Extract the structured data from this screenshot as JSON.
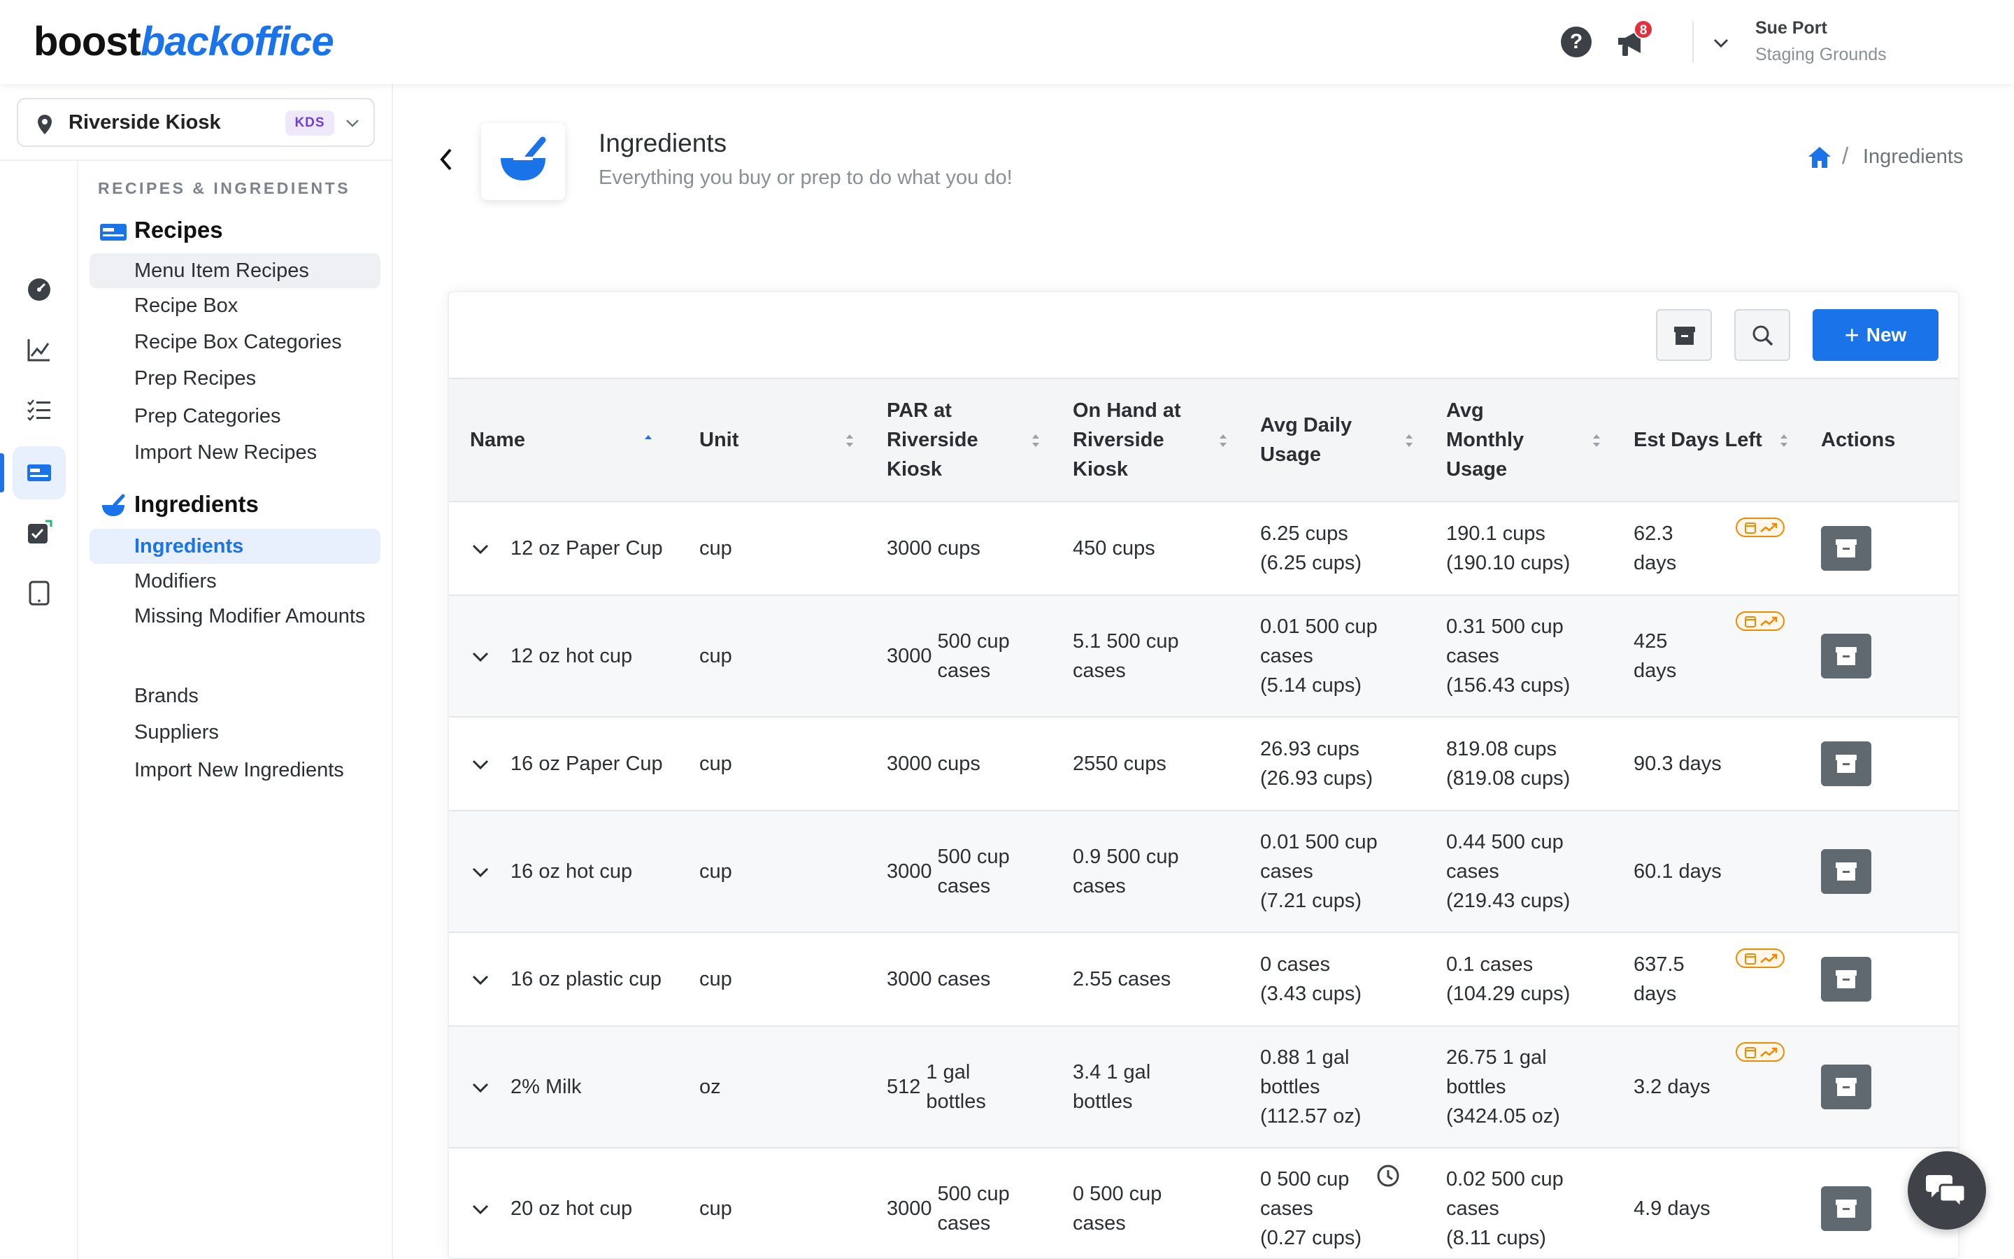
{
  "brand": {
    "part1": "boost",
    "part2": "backoffice"
  },
  "topbar": {
    "help_icon": "question-circle-icon",
    "notifications_icon": "megaphone-icon",
    "notification_count": "8",
    "user_name": "Sue Port",
    "user_location": "Staging Grounds"
  },
  "location": {
    "name": "Riverside Kiosk",
    "badge": "KDS"
  },
  "sidebar": {
    "section_title": "RECIPES & INGREDIENTS",
    "recipes_group": "Recipes",
    "recipes_items": [
      "Menu Item Recipes",
      "Recipe Box",
      "Recipe Box Categories",
      "Prep Recipes",
      "Prep Categories",
      "Import New Recipes"
    ],
    "ingredients_group": "Ingredients",
    "ingredients_items": [
      "Ingredients",
      "Modifiers",
      "Missing Modifier Amounts",
      "Brands",
      "Suppliers",
      "Import New Ingredients"
    ]
  },
  "header": {
    "title": "Ingredients",
    "subtitle": "Everything you buy or prep to do what you do!",
    "breadcrumb_current": "Ingredients",
    "breadcrumb_sep": "/"
  },
  "toolbar": {
    "new_label": "New"
  },
  "table": {
    "columns": [
      {
        "label": "Name"
      },
      {
        "label": "Unit"
      },
      {
        "label": "PAR at Riverside Kiosk"
      },
      {
        "label": "On Hand at Riverside Kiosk"
      },
      {
        "label": "Avg Daily Usage"
      },
      {
        "label": "Avg Monthly Usage"
      },
      {
        "label": "Est Days Left"
      },
      {
        "label": "Actions"
      }
    ],
    "rows": [
      {
        "name": "12 oz Paper Cup",
        "unit": "cup",
        "par_qty": "",
        "par_unit": "3000 cups",
        "on_hand": "450 cups",
        "daily_a": "6.25 cups",
        "daily_b": "(6.25 cups)",
        "monthly_a": "190.1 cups",
        "monthly_b": "(190.10 cups)",
        "days": "62.3 days",
        "trend": true,
        "history": false
      },
      {
        "name": "12 oz hot cup",
        "unit": "cup",
        "par_qty": "3000",
        "par_unit": "500 cup cases",
        "on_hand": "5.1 500 cup cases",
        "daily_a": "0.01 500 cup cases",
        "daily_b": "(5.14 cups)",
        "monthly_a": "0.31 500 cup cases",
        "monthly_b": "(156.43 cups)",
        "days": "425 days",
        "trend": true,
        "history": false
      },
      {
        "name": "16 oz Paper Cup",
        "unit": "cup",
        "par_qty": "",
        "par_unit": "3000 cups",
        "on_hand": "2550 cups",
        "daily_a": "26.93 cups",
        "daily_b": "(26.93 cups)",
        "monthly_a": "819.08 cups",
        "monthly_b": "(819.08 cups)",
        "days": "90.3 days",
        "trend": false,
        "history": false
      },
      {
        "name": "16 oz hot cup",
        "unit": "cup",
        "par_qty": "3000",
        "par_unit": "500 cup cases",
        "on_hand": "0.9 500 cup cases",
        "daily_a": "0.01 500 cup cases",
        "daily_b": "(7.21 cups)",
        "monthly_a": "0.44 500 cup cases",
        "monthly_b": "(219.43 cups)",
        "days": "60.1 days",
        "trend": false,
        "history": false
      },
      {
        "name": "16 oz plastic cup",
        "unit": "cup",
        "par_qty": "",
        "par_unit": "3000 cases",
        "on_hand": "2.55 cases",
        "daily_a": "0 cases",
        "daily_b": "(3.43 cups)",
        "monthly_a": "0.1 cases",
        "monthly_b": "(104.29 cups)",
        "days": "637.5 days",
        "trend": true,
        "history": false
      },
      {
        "name": "2% Milk",
        "unit": "oz",
        "par_qty": "512",
        "par_unit": "1 gal bottles",
        "on_hand": "3.4 1 gal bottles",
        "daily_a": "0.88 1 gal bottles",
        "daily_b": "(112.57 oz)",
        "monthly_a": "26.75 1 gal bottles",
        "monthly_b": "(3424.05 oz)",
        "days": "3.2 days",
        "trend": true,
        "history": false
      },
      {
        "name": "20 oz hot cup",
        "unit": "cup",
        "par_qty": "3000",
        "par_unit": "500 cup cases",
        "on_hand": "0 500 cup cases",
        "daily_a": "0 500 cup cases",
        "daily_b": "(0.27 cups)",
        "monthly_a": "0.02 500 cup cases",
        "monthly_b": "(8.11 cups)",
        "days": "4.9 days",
        "trend": false,
        "history": true
      }
    ]
  },
  "colors": {
    "accent": "#1a73e8",
    "warning": "#f08a00",
    "badge_red": "#e0313f"
  }
}
